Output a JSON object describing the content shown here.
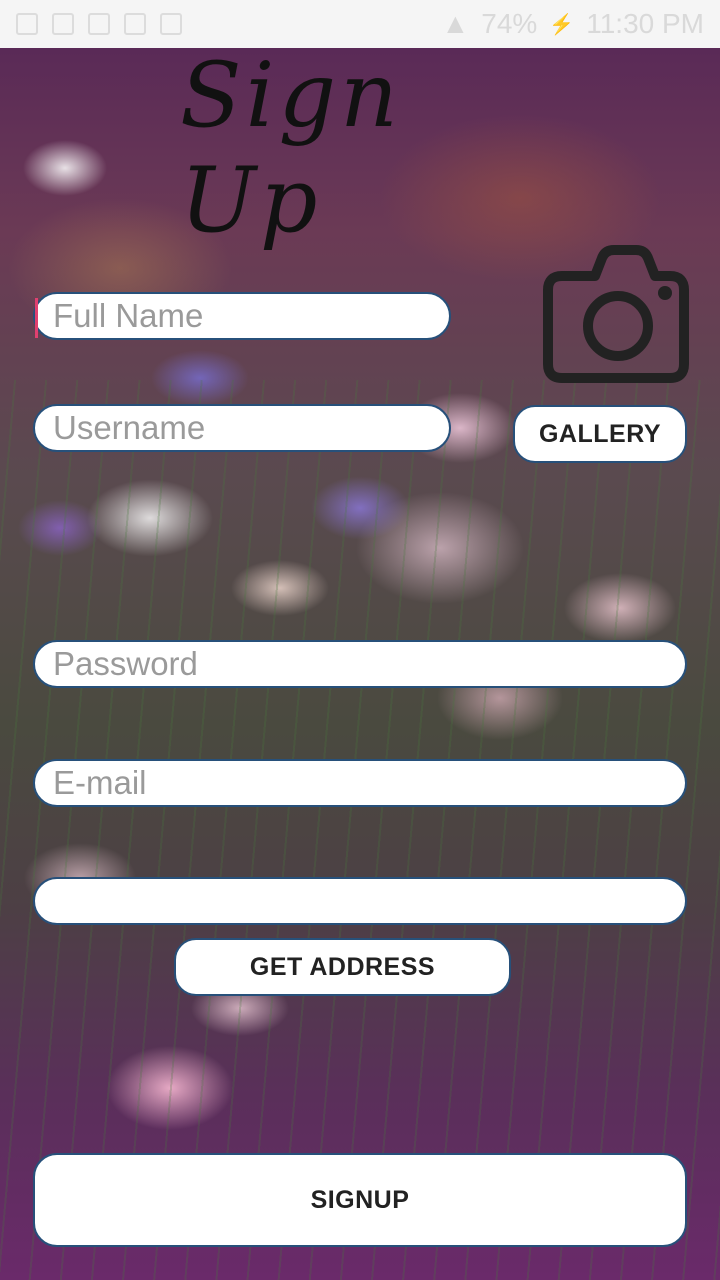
{
  "status_bar": {
    "battery": "74%",
    "time": "11:30 PM"
  },
  "title": "Sign Up",
  "form": {
    "full_name_placeholder": "Full Name",
    "username_placeholder": "Username",
    "password_placeholder": "Password",
    "email_placeholder": "E-mail",
    "address_placeholder": ""
  },
  "buttons": {
    "gallery": "GALLERY",
    "get_address": "GET ADDRESS",
    "signup": "SIGNUP"
  },
  "colors": {
    "field_border": "#27507a",
    "caret": "#e04070"
  },
  "icons": {
    "photo": "camera-icon"
  }
}
